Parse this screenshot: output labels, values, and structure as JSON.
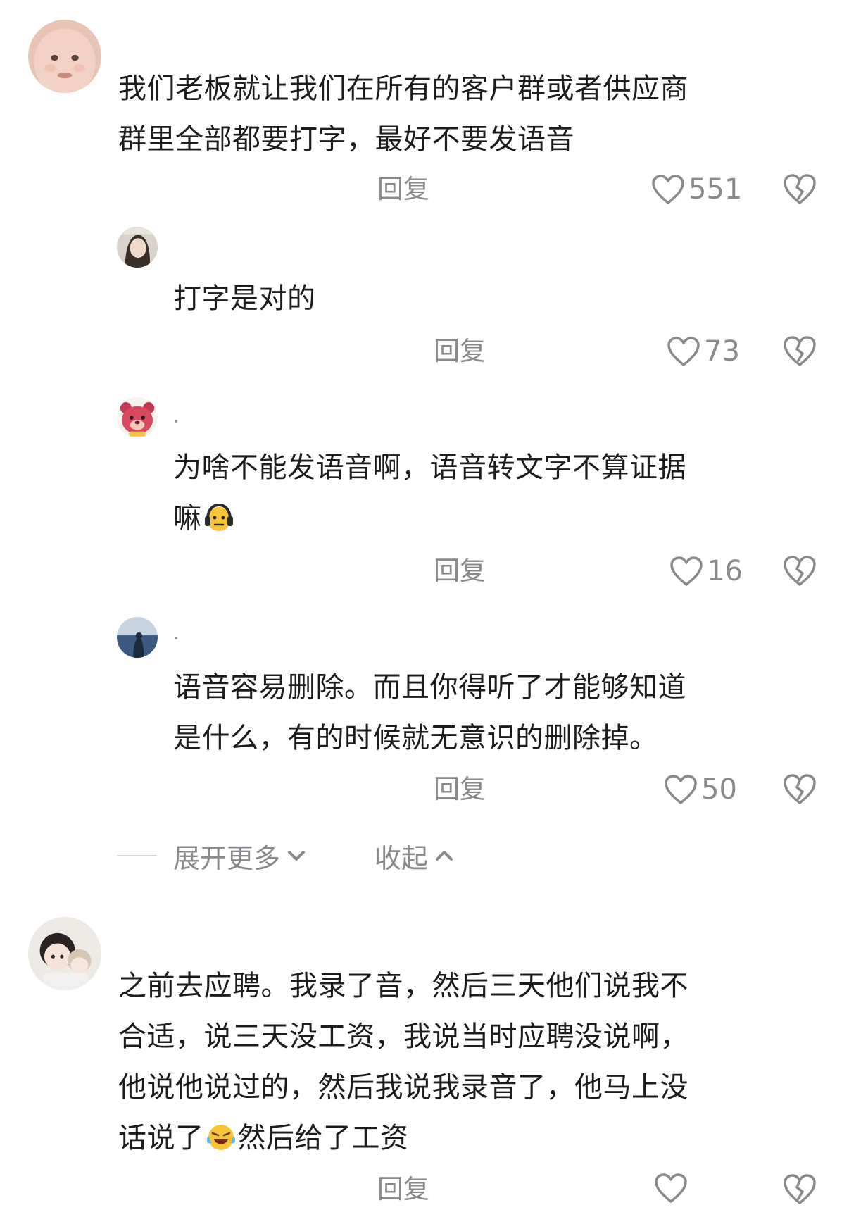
{
  "comments": [
    {
      "avatar": "baby-face-avatar",
      "lines": [
        "我们老板就让我们在所有的客户群或者供应商",
        "群里全部都要打字，最好不要发语音"
      ],
      "reply_label": "回复",
      "likes": "551"
    },
    {
      "avatar": "woman-photo-avatar",
      "lines": [
        "打字是对的"
      ],
      "reply_label": "回复",
      "likes": "73"
    },
    {
      "avatar": "pink-bear-avatar",
      "lines": [
        "为啥不能发语音啊，语音转文字不算证据",
        "嘛"
      ],
      "emoji": "headphones-face-emoji",
      "reply_label": "回复",
      "likes": "16"
    },
    {
      "avatar": "seaside-photo-avatar",
      "lines": [
        "语音容易删除。而且你得听了才能够知道",
        "是什么，有的时候就无意识的删除掉。"
      ],
      "reply_label": "回复",
      "likes": "50"
    },
    {
      "avatar": "cartoon-kids-avatar",
      "lines": [
        "之前去应聘。我录了音，然后三天他们说我不",
        "合适，说三天没工资，我说当时应聘没说啊，",
        "他说他说过的，然后我说我录音了，他马上没",
        "话说了",
        "然后给了工资"
      ],
      "emoji": "laughing-crying-emoji",
      "reply_label": "回复"
    }
  ],
  "thread_controls": {
    "expand_more": "展开更多",
    "collapse": "收起"
  },
  "colors": {
    "text": "#1c1c1e",
    "secondary": "#8a8a8e",
    "background": "#ffffff"
  }
}
